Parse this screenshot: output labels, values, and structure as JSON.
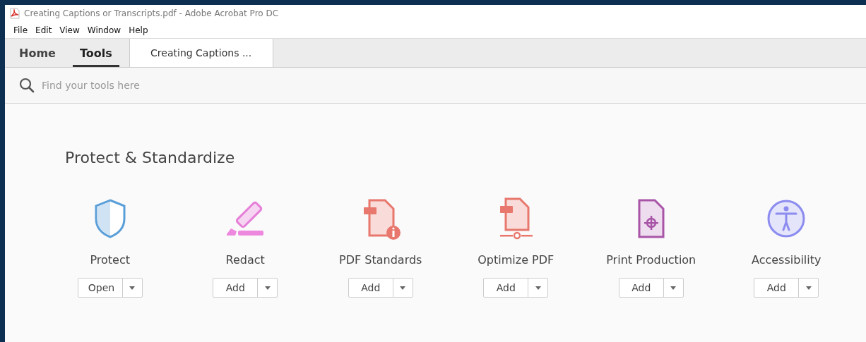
{
  "window": {
    "title": "Creating Captions or Transcripts.pdf - Adobe Acrobat Pro DC"
  },
  "menu": [
    "File",
    "Edit",
    "View",
    "Window",
    "Help"
  ],
  "tabs": [
    {
      "label": "Home",
      "selected": false
    },
    {
      "label": "Tools",
      "selected": true
    }
  ],
  "document_tab": {
    "label": "Creating Captions ..."
  },
  "search": {
    "placeholder": "Find your tools here"
  },
  "section": {
    "title": "Protect & Standardize"
  },
  "tools": [
    {
      "kind": "shield",
      "name": "Protect",
      "action": "Open"
    },
    {
      "kind": "marker",
      "name": "Redact",
      "action": "Add"
    },
    {
      "kind": "standards",
      "name": "PDF Standards",
      "action": "Add"
    },
    {
      "kind": "optimize",
      "name": "Optimize PDF",
      "action": "Add"
    },
    {
      "kind": "print",
      "name": "Print Production",
      "action": "Add"
    },
    {
      "kind": "accessibility",
      "name": "Accessibility",
      "action": "Add"
    }
  ]
}
